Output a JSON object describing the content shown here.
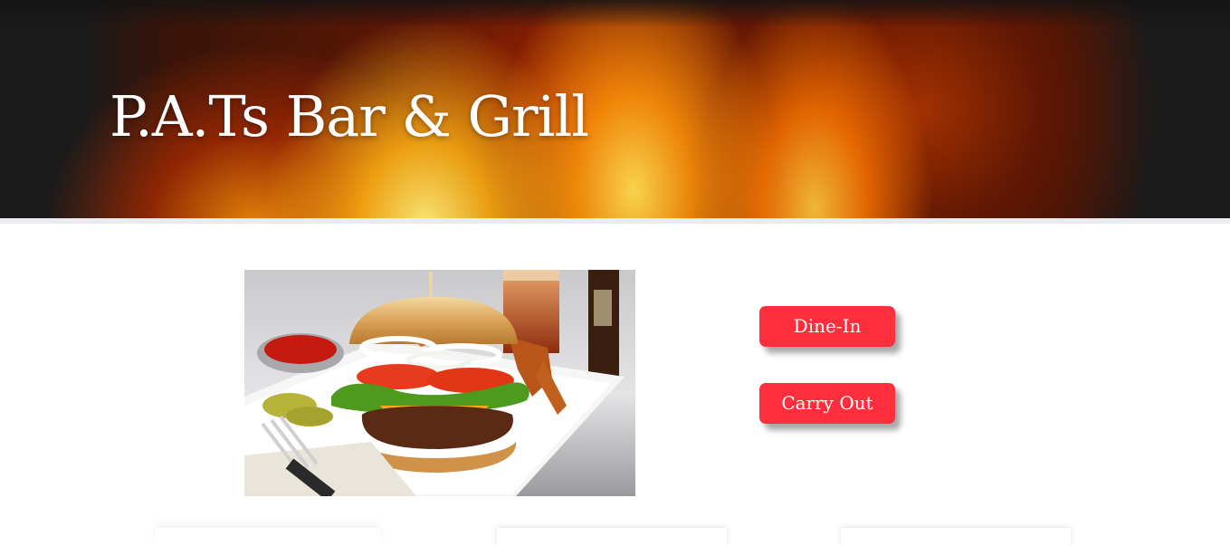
{
  "header": {
    "site_title": "P.A.Ts Bar & Grill"
  },
  "main": {
    "photo_alt": "Burger with fries and beer",
    "buttons": {
      "dine_in": "Dine-In",
      "carry_out": "Carry Out"
    }
  },
  "colors": {
    "button": "#fe2e3c",
    "button_text": "#ffffff",
    "title_text": "#ffffff",
    "header_strip": "#e9ebee"
  }
}
